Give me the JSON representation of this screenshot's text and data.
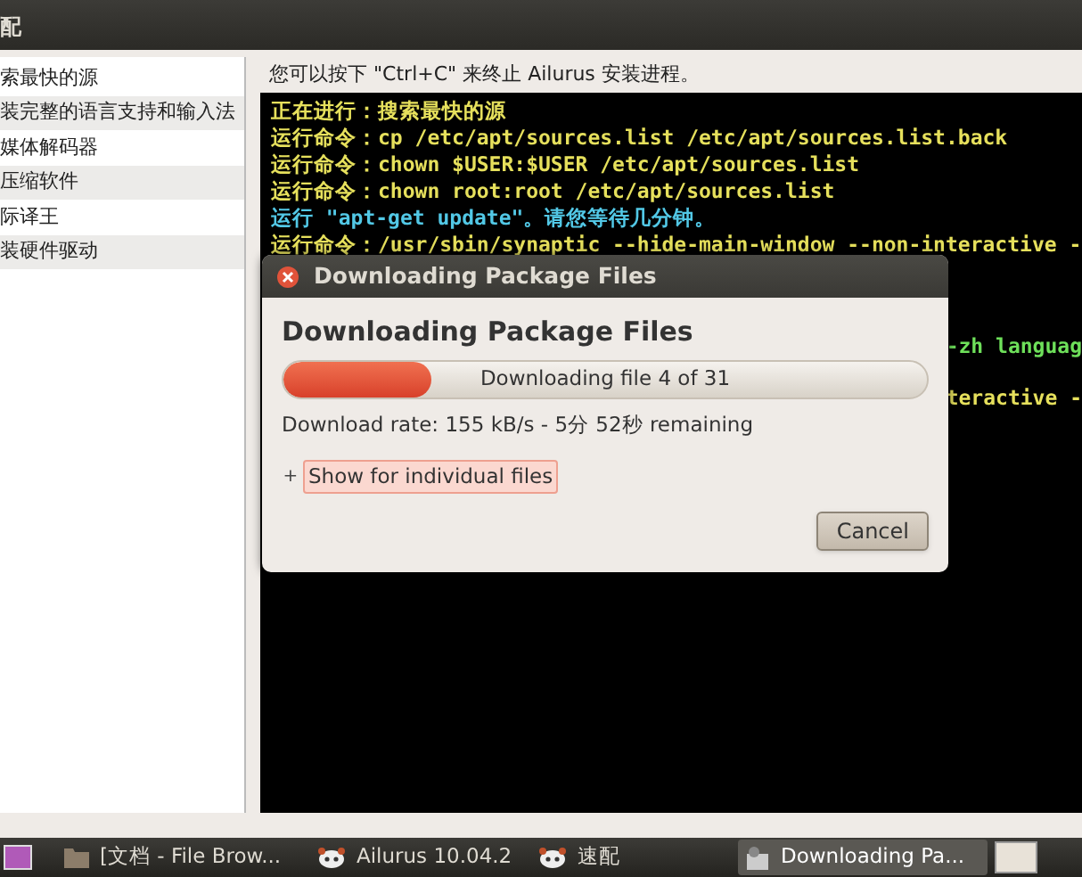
{
  "window": {
    "title": "配"
  },
  "sidebar": {
    "items": [
      {
        "label": "索最快的源",
        "selected": false
      },
      {
        "label": "装完整的语言支持和输入法",
        "selected": false
      },
      {
        "label": "媒体解码器",
        "selected": false
      },
      {
        "label": "压缩软件",
        "selected": false
      },
      {
        "label": "际译王",
        "selected": false
      },
      {
        "label": "装硬件驱动",
        "selected": false
      }
    ]
  },
  "hint": "您可以按下 \"Ctrl+C\" 来终止 Ailurus 安装进程。",
  "terminal": {
    "lines": [
      {
        "text": "正在进行：搜索最快的源",
        "color": "#e6e05c",
        "kind": "line"
      },
      {
        "text": "运行命令：cp /etc/apt/sources.list /etc/apt/sources.list.back",
        "color": "#e6e05c",
        "kind": "line"
      },
      {
        "text": "运行命令：chown $USER:$USER /etc/apt/sources.list",
        "color": "#e6e05c",
        "kind": "line"
      },
      {
        "text": "运行命令：chown root:root /etc/apt/sources.list",
        "color": "#e6e05c",
        "kind": "line"
      },
      {
        "text": "运行 \"apt-get update\"。请您等待几分钟。",
        "color": "#52c8e6",
        "kind": "line"
      },
      {
        "text": "运行命令：/usr/sbin/synaptic --hide-main-window --non-interactive -",
        "color": "#e6e05c",
        "kind": "line"
      },
      {
        "text": "-zh languag",
        "color": "#6ee05a",
        "kind": "fragment"
      },
      {
        "text": "teractive -",
        "color": "#e6e05c",
        "kind": "fragment"
      }
    ]
  },
  "dialog": {
    "title": "Downloading Package Files",
    "heading": "Downloading Package Files",
    "progress": {
      "level": 0.23,
      "label": "Downloading file 4 of 31"
    },
    "rate": "Download rate: 155 kB/s - 5分 52秒 remaining",
    "expander": {
      "label": "Show for individual files",
      "expanded": false,
      "expander_mark": "+"
    },
    "buttons": [
      "Cancel"
    ]
  },
  "taskbar": {
    "items": [
      {
        "label": "[文档 - File Brow...",
        "selected": false,
        "kind": "folder"
      },
      {
        "label": "Ailurus 10.04.2",
        "selected": false,
        "kind": "app"
      },
      {
        "label": "速配",
        "selected": false,
        "kind": "app"
      },
      {
        "label": "Downloading Pa...",
        "selected": true,
        "kind": "package"
      }
    ]
  }
}
